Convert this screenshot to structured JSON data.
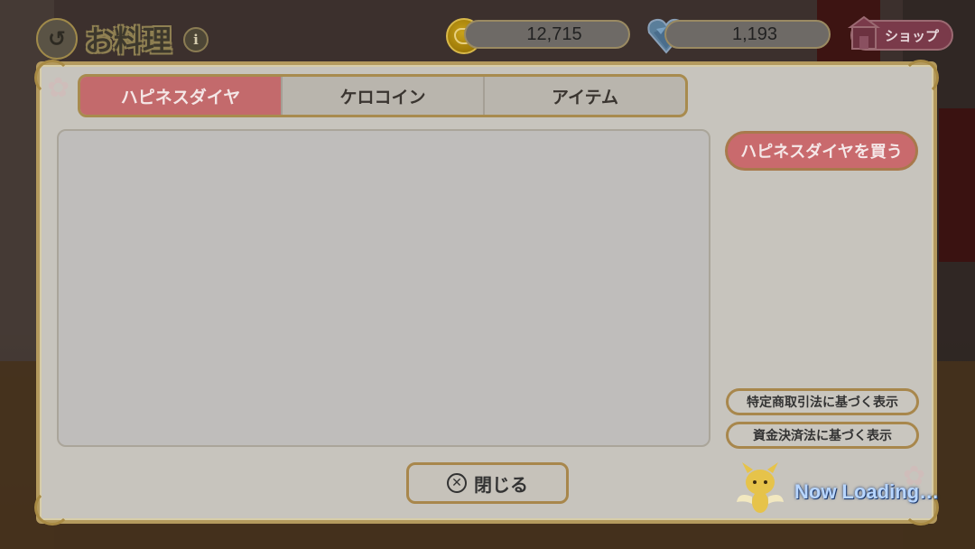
{
  "header": {
    "title": "お料理",
    "info_icon": "i",
    "coins": "12,715",
    "gems": "1,193",
    "shop_label": "ショップ"
  },
  "tabs": [
    {
      "label": "ハピネスダイヤ",
      "active": true
    },
    {
      "label": "ケロコイン",
      "active": false
    },
    {
      "label": "アイテム",
      "active": false
    }
  ],
  "side": {
    "buy_label": "ハピネスダイヤを買う",
    "legal_1": "特定商取引法に基づく表示",
    "legal_2": "資金決済法に基づく表示"
  },
  "footer": {
    "close_label": "閉じる",
    "loading_text": "Now Loading…"
  },
  "colors": {
    "accent_tab": "#c36a6c",
    "frame_gold": "#a88b4e",
    "panel_bg": "#c7c4bd"
  }
}
